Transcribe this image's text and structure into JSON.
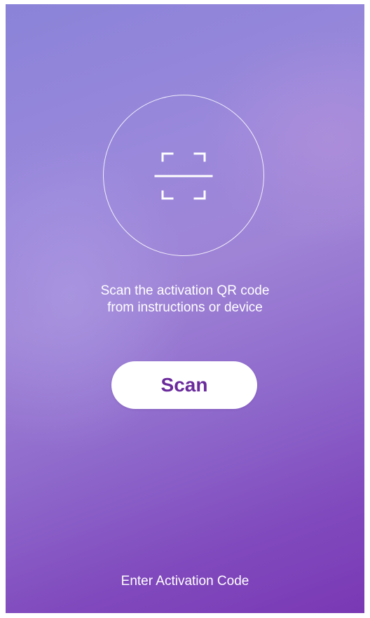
{
  "scan": {
    "icon": "qr-scan-icon",
    "instruction_line1": "Scan the activation QR code",
    "instruction_line2": "from instructions or device",
    "button_label": "Scan"
  },
  "footer": {
    "activation_link": "Enter Activation Code"
  },
  "colors": {
    "background_top": "#8a83d8",
    "background_bottom": "#7a38b4",
    "button_text": "#6a2a9c",
    "foreground": "#ffffff"
  }
}
